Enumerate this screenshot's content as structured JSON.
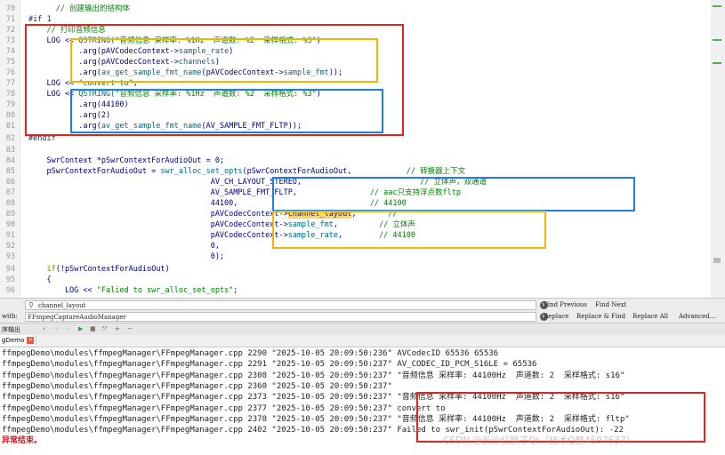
{
  "editor": {
    "lines": [
      {
        "n": "70",
        "parts": [
          [
            "      // 创建输出的结构体",
            "cm"
          ]
        ]
      },
      {
        "n": "71",
        "parts": [
          [
            "#if 1",
            "pp"
          ]
        ]
      },
      {
        "n": "72",
        "parts": [
          [
            "    // 打印音频信息",
            "cm"
          ]
        ]
      },
      {
        "n": "73",
        "parts": [
          [
            "    LOG << ",
            "tx"
          ],
          [
            "QSTRING(",
            "fn"
          ],
          [
            "\"音频信息 采样率: %1Hz  声道数: %2  采样格式: %3\"",
            "str"
          ],
          [
            ")",
            "tx"
          ]
        ]
      },
      {
        "n": "74",
        "parts": [
          [
            "           .arg(pAVCodecContext->",
            "tx"
          ],
          [
            "sample_rate",
            "fn"
          ],
          [
            ")",
            "tx"
          ]
        ]
      },
      {
        "n": "75",
        "parts": [
          [
            "           .arg(pAVCodecContext->",
            "tx"
          ],
          [
            "channels",
            "fn"
          ],
          [
            ")",
            "tx"
          ]
        ]
      },
      {
        "n": "76",
        "parts": [
          [
            "           .arg(",
            "tx"
          ],
          [
            "av_get_sample_fmt_name",
            "fn"
          ],
          [
            "(pAVCodecContext->",
            "tx"
          ],
          [
            "sample_fmt",
            "fn"
          ],
          [
            "));",
            "tx"
          ]
        ]
      },
      {
        "n": "77",
        "parts": [
          [
            "    LOG << ",
            "tx"
          ],
          [
            "\"convert to\"",
            "str"
          ],
          [
            ";",
            "tx"
          ]
        ]
      },
      {
        "n": "78",
        "parts": [
          [
            "    LOG << ",
            "tx"
          ],
          [
            "QSTRING(",
            "fn"
          ],
          [
            "\"音频信息 采样率: %1Hz  声道数: %2  采样格式: %3\"",
            "str"
          ],
          [
            ")",
            "tx"
          ]
        ]
      },
      {
        "n": "79",
        "parts": [
          [
            "           .arg(44100)",
            "tx"
          ]
        ]
      },
      {
        "n": "80",
        "parts": [
          [
            "           .arg(2)",
            "tx"
          ]
        ]
      },
      {
        "n": "81",
        "parts": [
          [
            "           .arg(",
            "tx"
          ],
          [
            "av_get_sample_fmt_name",
            "fn"
          ],
          [
            "(AV_SAMPLE_FMT_FLTP));",
            "tx"
          ]
        ]
      },
      {
        "n": "82",
        "parts": [
          [
            "#endif",
            "pp"
          ]
        ]
      },
      {
        "n": "83",
        "parts": [
          [
            "",
            "tx"
          ]
        ]
      },
      {
        "n": "84",
        "parts": [
          [
            "    SwrContext *pSwrContextForAudioOut = 0;",
            "tx"
          ]
        ]
      },
      {
        "n": "85",
        "parts": [
          [
            "    pSwrContextForAudioOut = ",
            "tx"
          ],
          [
            "swr_alloc_set_opts",
            "fn"
          ],
          [
            "(pSwrContextForAudioOut,            ",
            "tx"
          ],
          [
            "// 转换器上下文",
            "cm"
          ]
        ]
      },
      {
        "n": "86",
        "parts": [
          [
            "                                        AV_CH_LAYOUT_STEREO,                          ",
            "tx"
          ],
          [
            "// 立体声，双通道",
            "cm"
          ]
        ]
      },
      {
        "n": "87",
        "parts": [
          [
            "                                        AV_SAMPLE_FMT_FLTP,                ",
            "tx"
          ],
          [
            "// aac只支持浮点数fltp",
            "cm"
          ]
        ]
      },
      {
        "n": "88",
        "parts": [
          [
            "                                        44100,                             ",
            "tx"
          ],
          [
            "// 44100",
            "cm"
          ]
        ]
      },
      {
        "n": "89",
        "parts": [
          [
            "                                        pAVCodecContext->",
            "tx"
          ],
          [
            "channel_layout",
            "hl"
          ],
          [
            ",       ",
            "tx"
          ],
          [
            "//",
            "cm"
          ]
        ]
      },
      {
        "n": "90",
        "parts": [
          [
            "                                        pAVCodecContext->",
            "tx"
          ],
          [
            "sample_fmt",
            "fn"
          ],
          [
            ",         ",
            "tx"
          ],
          [
            "// 立体声",
            "cm"
          ]
        ]
      },
      {
        "n": "91",
        "parts": [
          [
            "                                        pAVCodecContext->",
            "tx"
          ],
          [
            "sample_rate",
            "fn"
          ],
          [
            ",        ",
            "tx"
          ],
          [
            "// 44100",
            "cm"
          ]
        ]
      },
      {
        "n": "92",
        "parts": [
          [
            "                                        0,",
            "tx"
          ]
        ]
      },
      {
        "n": "93",
        "parts": [
          [
            "                                        0);",
            "tx"
          ]
        ]
      },
      {
        "n": "94",
        "parts": [
          [
            "    if(!pSwrContextForAudioOut)",
            "kwline"
          ]
        ]
      },
      {
        "n": "95",
        "parts": [
          [
            "    {",
            "tx"
          ]
        ]
      },
      {
        "n": "96",
        "parts": [
          [
            "        LOG << ",
            "tx"
          ],
          [
            "\"Falied to swr_alloc_set_opts\"",
            "str"
          ],
          [
            ";",
            "tx"
          ]
        ]
      }
    ]
  },
  "find_bar": {
    "search_value": "channel_layout",
    "replace_label": "with:",
    "replace_value": "FFmpegCaptureAudioManager",
    "find_previous": "Find Previous",
    "find_next": "Find Next",
    "replace": "Replace",
    "replace_find": "Replace & Find",
    "replace_all": "Replace All",
    "advanced": "Advanced..."
  },
  "output_header": {
    "title": "序输出"
  },
  "output_tab": {
    "label": "gDemo"
  },
  "output": {
    "lines": [
      "ffmpegDemo\\modules\\ffmpegManager\\FFmpegManager.cpp 2290 \"2025-10-05 20:09:50:236\" AVCodecID 65536 65536",
      "ffmpegDemo\\modules\\ffmpegManager\\FFmpegManager.cpp 2291 \"2025-10-05 20:09:50:237\" AV_CODEC_ID_PCM_S16LE = 65536",
      "ffmpegDemo\\modules\\ffmpegManager\\FFmpegManager.cpp 2308 \"2025-10-05 20:09:50:237\" \"音频信息 采样率: 44100Hz  声道数: 2  采样格式: s16\"",
      "ffmpegDemo\\modules\\ffmpegManager\\FFmpegManager.cpp 2360 \"2025-10-05 20:09:50:237\"",
      "ffmpegDemo\\modules\\ffmpegManager\\FFmpegManager.cpp 2373 \"2025-10-05 20:09:50:237\" \"音频信息 采样率: 44100Hz  声道数: 2  采样格式: s16\"",
      "ffmpegDemo\\modules\\ffmpegManager\\FFmpegManager.cpp 2377 \"2025-10-05 20:09:50:237\" convert to",
      "ffmpegDemo\\modules\\ffmpegManager\\FFmpegManager.cpp 2378 \"2025-10-05 20:09:50:237\" \"音频信息 采样率: 44100Hz  声道数: 2  采样格式: fltp\"",
      "ffmpegDemo\\modules\\ffmpegManager\\FFmpegManager.cpp 2402 \"2025-10-05 20:09:50:237\" Failed to swr_init(pSwrContextForAudioOut): -22"
    ],
    "error_line": "异常结束。"
  },
  "watermark": "CSDN @长沙红胖子Qt（技术Q群4597637）",
  "colors": {
    "box_red": "#e0261c",
    "box_yellow": "#f4b400",
    "box_blue": "#1e7ee6",
    "highlight": "#ffd75e"
  }
}
